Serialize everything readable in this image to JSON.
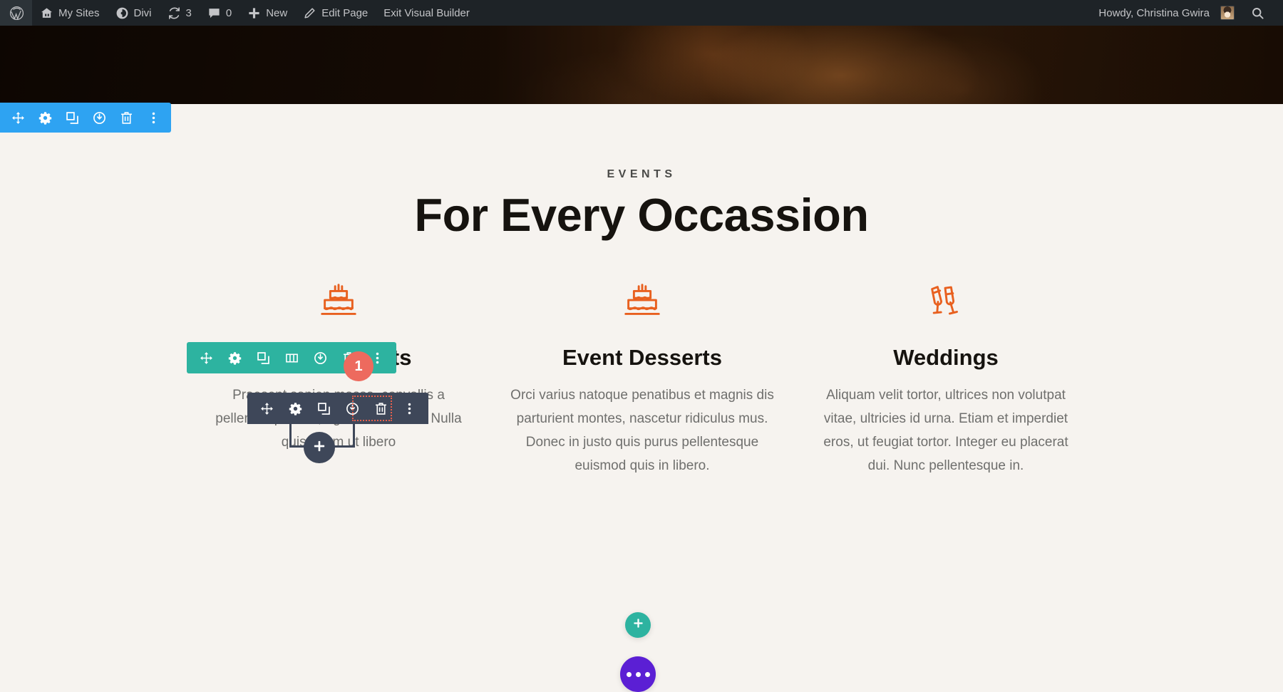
{
  "adminbar": {
    "logo_icon": "wordpress-icon",
    "items": [
      {
        "label": "My Sites",
        "icon": "sites-icon"
      },
      {
        "label": "Divi",
        "icon": "divi-icon"
      },
      {
        "label": "3",
        "icon": "updates-icon"
      },
      {
        "label": "0",
        "icon": "comments-icon"
      },
      {
        "label": "New",
        "icon": "plus-icon"
      },
      {
        "label": "Edit Page",
        "icon": "pencil-icon"
      },
      {
        "label": "Exit Visual Builder",
        "icon": "none"
      }
    ],
    "howdy": "Howdy, Christina Gwira",
    "avatar_icon": "avatar",
    "search_icon": "search-icon"
  },
  "section_toolbar": {
    "buttons": [
      {
        "name": "move-section",
        "icon": "move-icon"
      },
      {
        "name": "section-settings",
        "icon": "gear-icon"
      },
      {
        "name": "duplicate-section",
        "icon": "duplicate-icon"
      },
      {
        "name": "disable-section",
        "icon": "power-icon"
      },
      {
        "name": "delete-section",
        "icon": "trash-icon"
      },
      {
        "name": "section-more-options",
        "icon": "ellipsis-vertical-icon"
      }
    ],
    "color": "#2ea3f2"
  },
  "row_toolbar": {
    "buttons": [
      {
        "name": "move-row",
        "icon": "move-icon"
      },
      {
        "name": "row-settings",
        "icon": "gear-icon"
      },
      {
        "name": "duplicate-row",
        "icon": "duplicate-icon"
      },
      {
        "name": "row-columns",
        "icon": "columns-icon"
      },
      {
        "name": "disable-row",
        "icon": "power-icon"
      },
      {
        "name": "delete-row",
        "icon": "trash-icon"
      },
      {
        "name": "row-more-options",
        "icon": "ellipsis-vertical-icon"
      }
    ],
    "color": "#2db3a0",
    "badge": "1",
    "badge_color": "#ed6a5e"
  },
  "module_toolbar": {
    "buttons": [
      {
        "name": "move-module",
        "icon": "move-icon"
      },
      {
        "name": "module-settings",
        "icon": "gear-icon"
      },
      {
        "name": "duplicate-module",
        "icon": "duplicate-icon"
      },
      {
        "name": "disable-module",
        "icon": "power-icon"
      },
      {
        "name": "delete-module",
        "icon": "trash-icon"
      },
      {
        "name": "module-more-options",
        "icon": "ellipsis-vertical-icon"
      }
    ],
    "color": "#3e4759",
    "selection_color": "#e8604c",
    "add_module_icon": "plus-icon"
  },
  "content": {
    "eyebrow": "EVENTS",
    "headline": "For Every Occassion",
    "columns": [
      {
        "icon": "birthday-cake-icon",
        "title": "Birthday Gifts",
        "body": "Praesent sapien massa, convallis a pellentesque nec, egestas non nisi. Nulla quis lorem ut libero"
      },
      {
        "icon": "birthday-cake-icon",
        "title": "Event Desserts",
        "body": "Orci varius natoque penatibus et magnis dis parturient montes, nascetur ridiculus mus. Donec in justo quis purus pellentesque euismod quis in libero."
      },
      {
        "icon": "champagne-toast-icon",
        "title": "Weddings",
        "body": "Aliquam velit tortor, ultrices non volutpat vitae, ultricies id urna. Etiam et imperdiet eros, ut feugiat tortor. Integer eu placerat dui. Nunc pellentesque in."
      }
    ]
  },
  "fabs": {
    "add_row": {
      "name": "add-row-button",
      "icon": "plus-icon",
      "color": "#2db3a0"
    },
    "more": {
      "name": "builder-menu-button",
      "icon": "ellipsis-icon",
      "color": "#5b1fd4"
    }
  },
  "colors": {
    "accent_orange": "#e8601f",
    "page_background": "#f6f3ef",
    "heading": "#16130f",
    "body_text": "#6f6f6d"
  }
}
